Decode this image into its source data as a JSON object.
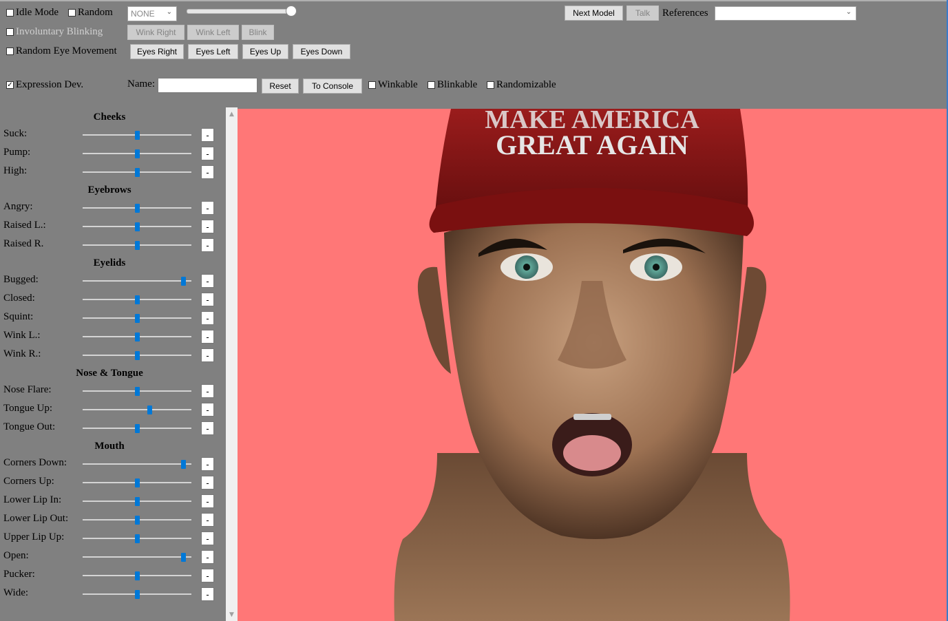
{
  "toolbar": {
    "idle_mode": {
      "label": "Idle Mode",
      "checked": false
    },
    "random": {
      "label": "Random",
      "checked": false
    },
    "mode_select": "NONE",
    "involuntary_blinking": {
      "label": "Involuntary Blinking",
      "checked": false
    },
    "random_eye_movement": {
      "label": "Random Eye Movement",
      "checked": false
    },
    "buttons": {
      "wink_right": "Wink Right",
      "wink_left": "Wink Left",
      "blink": "Blink",
      "eyes_right": "Eyes Right",
      "eyes_left": "Eyes Left",
      "eyes_up": "Eyes Up",
      "eyes_down": "Eyes Down",
      "next_model": "Next Model",
      "talk": "Talk",
      "reset": "Reset",
      "to_console": "To Console"
    },
    "references_label": "References",
    "references_value": "",
    "expression_dev": {
      "label": "Expression Dev.",
      "checked": true
    },
    "name_label": "Name:",
    "name_value": "",
    "winkable": {
      "label": "Winkable",
      "checked": false
    },
    "blinkable": {
      "label": "Blinkable",
      "checked": false
    },
    "randomizable": {
      "label": "Randomizable",
      "checked": false
    },
    "top_slider_value": 1.0
  },
  "panel": {
    "sections": [
      {
        "title": "Cheeks",
        "rows": [
          {
            "label": "Suck:",
            "value": 0.5,
            "readout": "-"
          },
          {
            "label": "Pump:",
            "value": 0.5,
            "readout": "-"
          },
          {
            "label": "High:",
            "value": 0.5,
            "readout": "-"
          }
        ]
      },
      {
        "title": "Eyebrows",
        "rows": [
          {
            "label": "Angry:",
            "value": 0.5,
            "readout": "-"
          },
          {
            "label": "Raised L.:",
            "value": 0.5,
            "readout": "-"
          },
          {
            "label": "Raised R.",
            "value": 0.5,
            "readout": "-"
          }
        ]
      },
      {
        "title": "Eyelids",
        "rows": [
          {
            "label": "Bugged:",
            "value": 0.95,
            "readout": "-"
          },
          {
            "label": "Closed:",
            "value": 0.5,
            "readout": "-"
          },
          {
            "label": "Squint:",
            "value": 0.5,
            "readout": "-"
          },
          {
            "label": "Wink L.:",
            "value": 0.5,
            "readout": "-"
          },
          {
            "label": "Wink R.:",
            "value": 0.5,
            "readout": "-"
          }
        ]
      },
      {
        "title": "Nose & Tongue",
        "rows": [
          {
            "label": "Nose Flare:",
            "value": 0.5,
            "readout": "-"
          },
          {
            "label": "Tongue Up:",
            "value": 0.62,
            "readout": "-"
          },
          {
            "label": "Tongue Out:",
            "value": 0.5,
            "readout": "-"
          }
        ]
      },
      {
        "title": "Mouth",
        "rows": [
          {
            "label": "Corners Down:",
            "value": 0.95,
            "readout": "-"
          },
          {
            "label": "Corners Up:",
            "value": 0.5,
            "readout": "-"
          },
          {
            "label": "Lower Lip In:",
            "value": 0.5,
            "readout": "-"
          },
          {
            "label": "Lower Lip Out:",
            "value": 0.5,
            "readout": "-"
          },
          {
            "label": "Upper Lip Up:",
            "value": 0.5,
            "readout": "-"
          },
          {
            "label": "Open:",
            "value": 0.95,
            "readout": "-"
          },
          {
            "label": "Pucker:",
            "value": 0.5,
            "readout": "-"
          },
          {
            "label": "Wide:",
            "value": 0.5,
            "readout": "-"
          }
        ]
      }
    ]
  },
  "viewport": {
    "background_color": "#ff7777",
    "cap_text_line1": "MAKE AMERICA",
    "cap_text_line2": "GREAT AGAIN"
  },
  "colors": {
    "slider_thumb": "#0078d7",
    "chrome": "#808080"
  }
}
